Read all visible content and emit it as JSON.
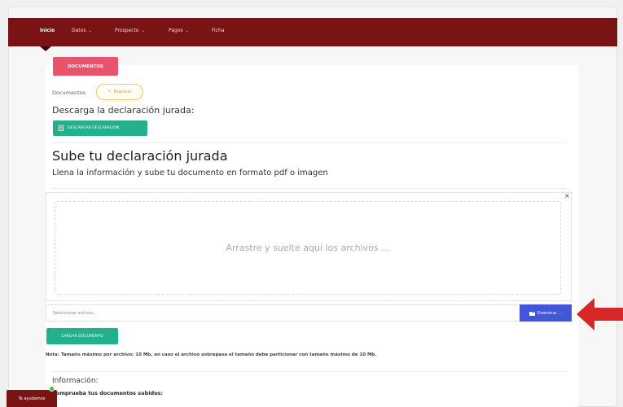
{
  "colors": {
    "navbar": "#7a1414",
    "danger_tab": "#e9536b",
    "success_button": "#24b08c",
    "primary_button": "#4257d8",
    "warning_pill": "#f5c66a",
    "callout_arrow": "#d62828"
  },
  "navbar": {
    "items": [
      {
        "label": "Inicio",
        "active": true
      },
      {
        "label": "Datos",
        "dropdown": true
      },
      {
        "label": "Prospecto",
        "dropdown": true
      },
      {
        "label": "Pagos",
        "dropdown": true
      },
      {
        "label": "Ficha"
      }
    ]
  },
  "documents": {
    "tab_label": "DOCUMENTOS",
    "label": "Documentos",
    "back_button_label": "Regresar",
    "back_icon": "back-arrow-icon",
    "download_heading": "Descarga la declaración jurada:",
    "download_button_label": "DESCARGAR DECLARACIÓN",
    "download_icon": "document-icon"
  },
  "upload": {
    "heading": "Sube tu declaración jurada",
    "subheading": "Llena la información y sube tu documento en formato pdf o imagen",
    "close_label": "×",
    "dropzone_text": "Arrastre y suelte aquí los archivos ...",
    "file_placeholder": "Seleccionar archivo...",
    "browse_button_label": "Examinar ...",
    "browse_icon": "folder-icon",
    "submit_button_label": "CARGAR DOCUMENTO",
    "note": "Nota: Tamaño máximo por archivo: 10 Mb, en caso el archivo sobrepasa el tamaño debe particionar con tamaño máximo de 10 Mb."
  },
  "info": {
    "title": "Información:",
    "subtitle": "Comprueba tus documentos subidos:"
  },
  "help": {
    "label": "Te ayudamos"
  }
}
